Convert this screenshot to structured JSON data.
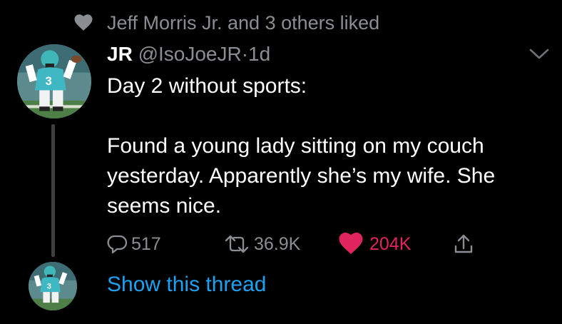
{
  "social_context": {
    "text": "Jeff Morris Jr. and 3 others liked",
    "icon": "heart-icon"
  },
  "tweet": {
    "display_name": "JR",
    "handle": "@IsoJoeJR",
    "separator": "·",
    "time": "1d",
    "text": "Day 2 without sports:\n\nFound a young lady sitting on my couch yesterday. Apparently she’s my wife. She seems nice.",
    "menu_icon": "chevron-down-icon"
  },
  "actions": {
    "reply_count": "517",
    "retweet_count": "36.9K",
    "like_count": "204K",
    "like_active": true,
    "share_icon": "share-icon"
  },
  "show_thread_label": "Show this thread",
  "colors": {
    "background": "#000000",
    "text": "#ffffff",
    "secondary": "#8a8d91",
    "link": "#1da1f2",
    "like": "#e0245e",
    "thread_line": "#3d4043"
  }
}
